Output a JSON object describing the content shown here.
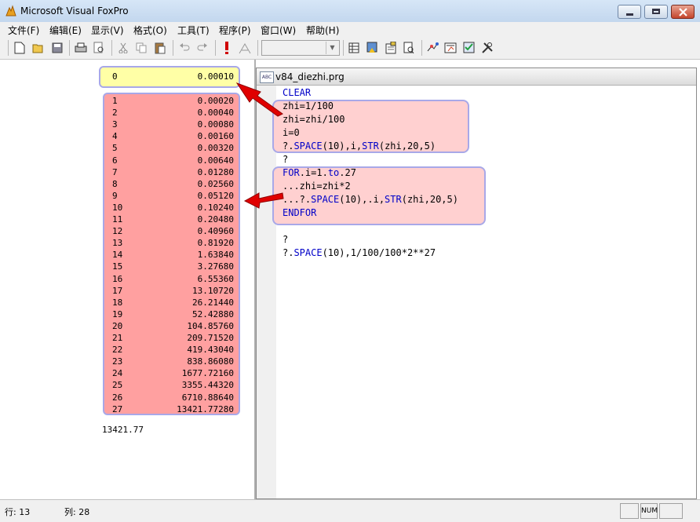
{
  "window": {
    "title": "Microsoft Visual FoxPro"
  },
  "menu": [
    "文件(F)",
    "编辑(E)",
    "显示(V)",
    "格式(O)",
    "工具(T)",
    "程序(P)",
    "窗口(W)",
    "帮助(H)"
  ],
  "toolbar": {
    "buttons": [
      "new-file-icon",
      "open-folder-icon",
      "save-icon",
      "print-icon",
      "print-preview-icon",
      "cut-icon",
      "copy-icon",
      "paste-icon",
      "undo-icon",
      "redo-icon",
      "run-icon",
      "modify-form-icon",
      "data-session-icon",
      "command-window-icon",
      "database-designer-icon",
      "properties-icon",
      "code-icon",
      "form-wizard-icon",
      "report-designer-icon",
      "toolbox-icon"
    ],
    "combo_value": ""
  },
  "output": {
    "first": {
      "index": "0",
      "value": "0.00010"
    },
    "rows": [
      {
        "index": "1",
        "value": "0.00020"
      },
      {
        "index": "2",
        "value": "0.00040"
      },
      {
        "index": "3",
        "value": "0.00080"
      },
      {
        "index": "4",
        "value": "0.00160"
      },
      {
        "index": "5",
        "value": "0.00320"
      },
      {
        "index": "6",
        "value": "0.00640"
      },
      {
        "index": "7",
        "value": "0.01280"
      },
      {
        "index": "8",
        "value": "0.02560"
      },
      {
        "index": "9",
        "value": "0.05120"
      },
      {
        "index": "10",
        "value": "0.10240"
      },
      {
        "index": "11",
        "value": "0.20480"
      },
      {
        "index": "12",
        "value": "0.40960"
      },
      {
        "index": "13",
        "value": "0.81920"
      },
      {
        "index": "14",
        "value": "1.63840"
      },
      {
        "index": "15",
        "value": "3.27680"
      },
      {
        "index": "16",
        "value": "6.55360"
      },
      {
        "index": "17",
        "value": "13.10720"
      },
      {
        "index": "18",
        "value": "26.21440"
      },
      {
        "index": "19",
        "value": "52.42880"
      },
      {
        "index": "20",
        "value": "104.85760"
      },
      {
        "index": "21",
        "value": "209.71520"
      },
      {
        "index": "22",
        "value": "419.43040"
      },
      {
        "index": "23",
        "value": "838.86080"
      },
      {
        "index": "24",
        "value": "1677.72160"
      },
      {
        "index": "25",
        "value": "3355.44320"
      },
      {
        "index": "26",
        "value": "6710.88640"
      },
      {
        "index": "27",
        "value": "13421.77280"
      }
    ],
    "result": "13421.77"
  },
  "editor": {
    "title": "v84_diezhi.prg",
    "lines": [
      [
        {
          "t": "CLEAR",
          "k": true
        }
      ],
      [
        {
          "t": "zhi=1/100",
          "k": false
        }
      ],
      [
        {
          "t": "zhi=zhi/100",
          "k": false
        }
      ],
      [
        {
          "t": "i=0",
          "k": false
        }
      ],
      [
        {
          "t": "?.",
          "k": false
        },
        {
          "t": "SPACE",
          "k": true
        },
        {
          "t": "(10),i,",
          "k": false
        },
        {
          "t": "STR",
          "k": true
        },
        {
          "t": "(zhi,20,5)",
          "k": false
        }
      ],
      [
        {
          "t": "?",
          "k": false
        }
      ],
      [
        {
          "t": "FOR",
          "k": true
        },
        {
          "t": ".i=1.",
          "k": false
        },
        {
          "t": "to",
          "k": true
        },
        {
          "t": ".27",
          "k": false
        }
      ],
      [
        {
          "t": "...zhi=zhi*2",
          "k": false
        }
      ],
      [
        {
          "t": "...?.",
          "k": false
        },
        {
          "t": "SPACE",
          "k": true
        },
        {
          "t": "(10),.i,",
          "k": false
        },
        {
          "t": "STR",
          "k": true
        },
        {
          "t": "(zhi,20,5)",
          "k": false
        }
      ],
      [
        {
          "t": "ENDFOR",
          "k": true
        }
      ],
      [],
      [
        {
          "t": "?",
          "k": false
        }
      ],
      [
        {
          "t": "?.",
          "k": false
        },
        {
          "t": "SPACE",
          "k": true
        },
        {
          "t": "(10),1/100/100*2**27",
          "k": false
        }
      ]
    ]
  },
  "status": {
    "row_label": "行: 13",
    "col_label": "列: 28",
    "num": "NUM"
  },
  "colors": {
    "keyword": "#0000c8",
    "highlight_yellow": "#ffffa6",
    "highlight_red": "#ffa0a0",
    "arrow": "#e00000"
  }
}
